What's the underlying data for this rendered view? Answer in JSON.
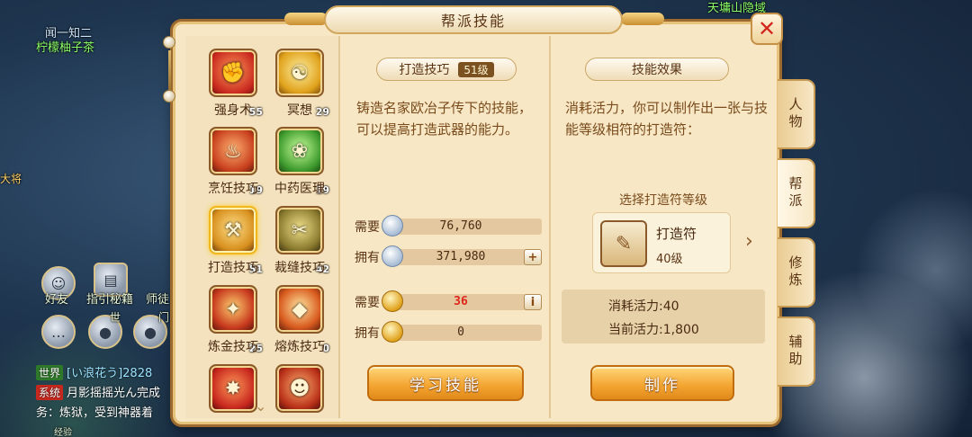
{
  "hud": {
    "top_right_text": "天墉山隐域",
    "player_title": "闻一知二",
    "player_name": "柠檬柚子茶",
    "npc_label": "大将",
    "friends_label": "好友",
    "guide_label": "指引秘籍",
    "master_label": "师徒",
    "world_label": "世",
    "gate_label": "门",
    "chat_lines": [
      {
        "tag": "世界",
        "text": "[い浪花う]2828"
      },
      {
        "tag": "系统",
        "text": "月影摇摇光ん完成"
      },
      {
        "tag": "",
        "text": "务：炼狱，受到神器着"
      }
    ],
    "xp_label": "经验"
  },
  "panel": {
    "title": "帮派技能",
    "close_icon": "close-icon"
  },
  "skills": [
    {
      "name": "强身术",
      "level": "55",
      "icon": "muscle-icon",
      "color": "#c8281e"
    },
    {
      "name": "冥想",
      "level": "29",
      "icon": "meditation-icon",
      "color": "#e0a21c"
    },
    {
      "name": "烹饪技巧",
      "level": "19",
      "icon": "cooking-icon",
      "color": "#c8401e"
    },
    {
      "name": "中药医理",
      "level": "19",
      "icon": "herb-icon",
      "color": "#3f9b2e"
    },
    {
      "name": "打造技巧",
      "level": "51",
      "icon": "hammer-icon",
      "color": "#d8901e",
      "selected": true
    },
    {
      "name": "裁缝技巧",
      "level": "42",
      "icon": "needle-icon",
      "color": "#8a7a2e"
    },
    {
      "name": "炼金技巧",
      "level": "25",
      "icon": "alchemy-icon",
      "color": "#c83a1e"
    },
    {
      "name": "熔炼技巧",
      "level": "0",
      "icon": "smelting-icon",
      "color": "#d85a1e"
    },
    {
      "name": "",
      "level": "19",
      "icon": "fire-skill-icon",
      "color": "#c8281e"
    },
    {
      "name": "",
      "level": "18",
      "icon": "mask-icon",
      "color": "#b83018"
    }
  ],
  "detail": {
    "skill_title": "打造技巧",
    "skill_level": "51级",
    "description": "铸造名家欧冶子传下的技能，可以提高打造武器的能力。",
    "need_label": "需要",
    "have_label": "拥有",
    "silver_need": "76,760",
    "silver_have": "371,980",
    "gold_need": "36",
    "gold_have": "0",
    "add_symbol": "+",
    "info_symbol": "i",
    "learn_button": "学习技能"
  },
  "effect": {
    "header": "技能效果",
    "text": "消耗活力，你可以制作出一张与技能等级相符的打造符：",
    "select_tier_label": "选择打造符等级",
    "item_name": "打造符",
    "item_level": "40级",
    "item_icon": "scroll-icon",
    "cost_vitality": "消耗活力:40",
    "current_vitality": "当前活力:1,800",
    "make_button": "制作"
  },
  "tabs": [
    {
      "label": "人物",
      "active": false
    },
    {
      "label": "帮派",
      "active": true
    },
    {
      "label": "修炼",
      "active": false
    },
    {
      "label": "辅助",
      "active": false
    }
  ]
}
